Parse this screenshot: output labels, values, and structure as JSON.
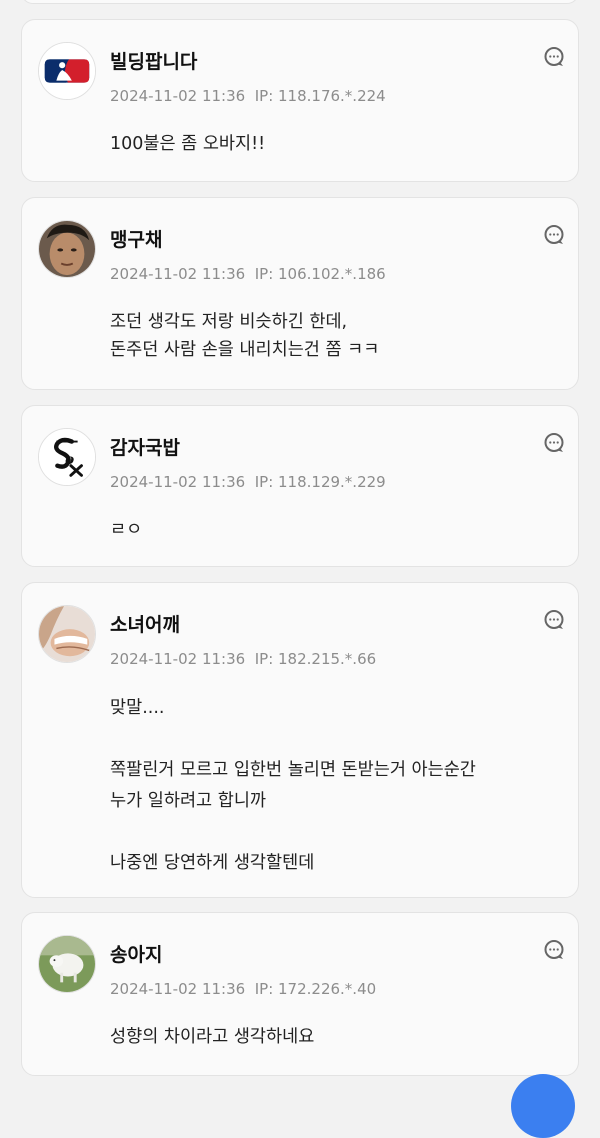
{
  "comments": [
    {
      "nickname": "빌딩팝니다",
      "date": "2024-11-02 11:36",
      "ip": "IP: 118.176.*.224",
      "avatar": "mlb-logo",
      "text": "100불은 좀 오바지!!"
    },
    {
      "nickname": "맹구채",
      "date": "2024-11-02 11:36",
      "ip": "IP: 106.102.*.186",
      "avatar": "person-photo",
      "text": "조던 생각도 저랑 비슷하긴 한데,\n돈주던 사람 손을 내리치는건 쫌 ㅋㅋ"
    },
    {
      "nickname": "감자국밥",
      "date": "2024-11-02 11:36",
      "ip": "IP: 118.129.*.229",
      "avatar": "white-sox-logo",
      "text": "ㄹㅇ"
    },
    {
      "nickname": "소녀어깨",
      "date": "2024-11-02 11:36",
      "ip": "IP: 182.215.*.66",
      "avatar": "person-photo",
      "text": "맞말....\n\n쪽팔린거 모르고 입한번 놀리면 돈받는거 아는순간\n누가 일하려고 합니까\n\n나중엔 당연하게 생각할텐데"
    },
    {
      "nickname": "송아지",
      "date": "2024-11-02 11:36",
      "ip": "IP: 172.226.*.40",
      "avatar": "calf-photo",
      "text": "성향의 차이라고 생각하네요"
    }
  ],
  "icons": {
    "reply": "reply-bubble-icon",
    "fab": "floating-action-button"
  },
  "colors": {
    "meta_text": "#8c8c8c",
    "card_bg": "#fafafa",
    "fab": "#3b7ff0"
  }
}
